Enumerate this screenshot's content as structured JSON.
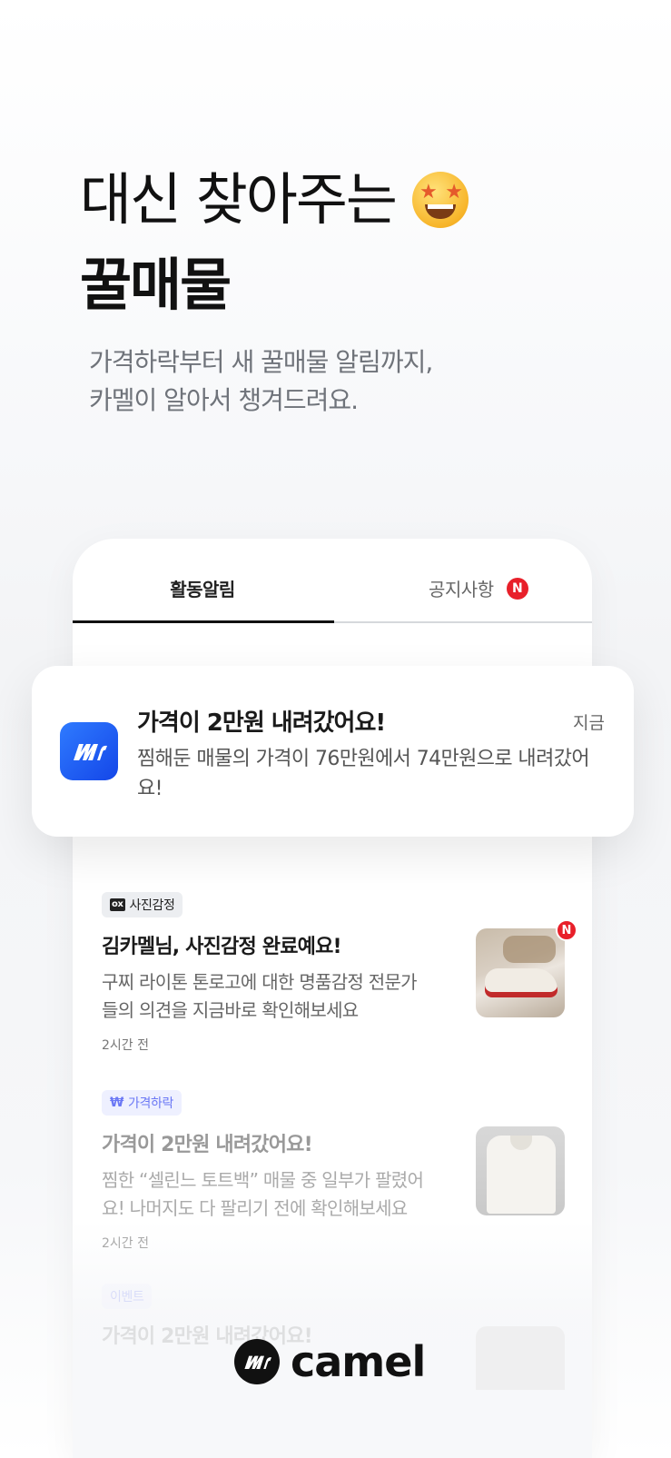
{
  "hero": {
    "line1": "대신 찾아주는",
    "line2": "꿀매물",
    "emoji_icon": "star-struck-emoji",
    "subtitle_line1": "가격하락부터 새 꿀매물 알림까지,",
    "subtitle_line2": "카멜이 알아서 챙겨드려요."
  },
  "tabs": {
    "active": "활동알림",
    "inactive": "공지사항",
    "inactive_badge": "N"
  },
  "push": {
    "app_icon": "camel-app-icon",
    "title": "가격이 2만원 내려갔어요!",
    "time": "지금",
    "body": "찜해둔 매물의 가격이 76만원에서 74만원으로 내려갔어요!"
  },
  "notifications": [
    {
      "tag_icon": "ox",
      "tag": "사진감정",
      "title": "김카멜님, 사진감정 완료예요!",
      "body_line1": "구찌 라이톤 톤로고에 대한 명품감정 전문가",
      "body_line2": "들의 의견을 지금바로 확인해보세요",
      "time": "2시간 전",
      "thumb_badge": "N"
    },
    {
      "tag_icon": "₩",
      "tag": "가격하락",
      "title": "가격이 2만원 내려갔어요!",
      "body_line1": "찜한 “셀린느 토트백” 매물 중 일부가 팔렸어",
      "body_line2": "요! 나머지도 다 팔리기 전에 확인해보세요",
      "time": "2시간 전"
    },
    {
      "tag": "이벤트",
      "title": "가격이 2만원 내려갔어요!"
    }
  ],
  "brand": {
    "logo_mark": "mr",
    "name": "camel"
  },
  "colors": {
    "badge_red": "#e8202a",
    "app_blue": "#1f5cf5",
    "price_tag_text": "#6b78f5"
  }
}
